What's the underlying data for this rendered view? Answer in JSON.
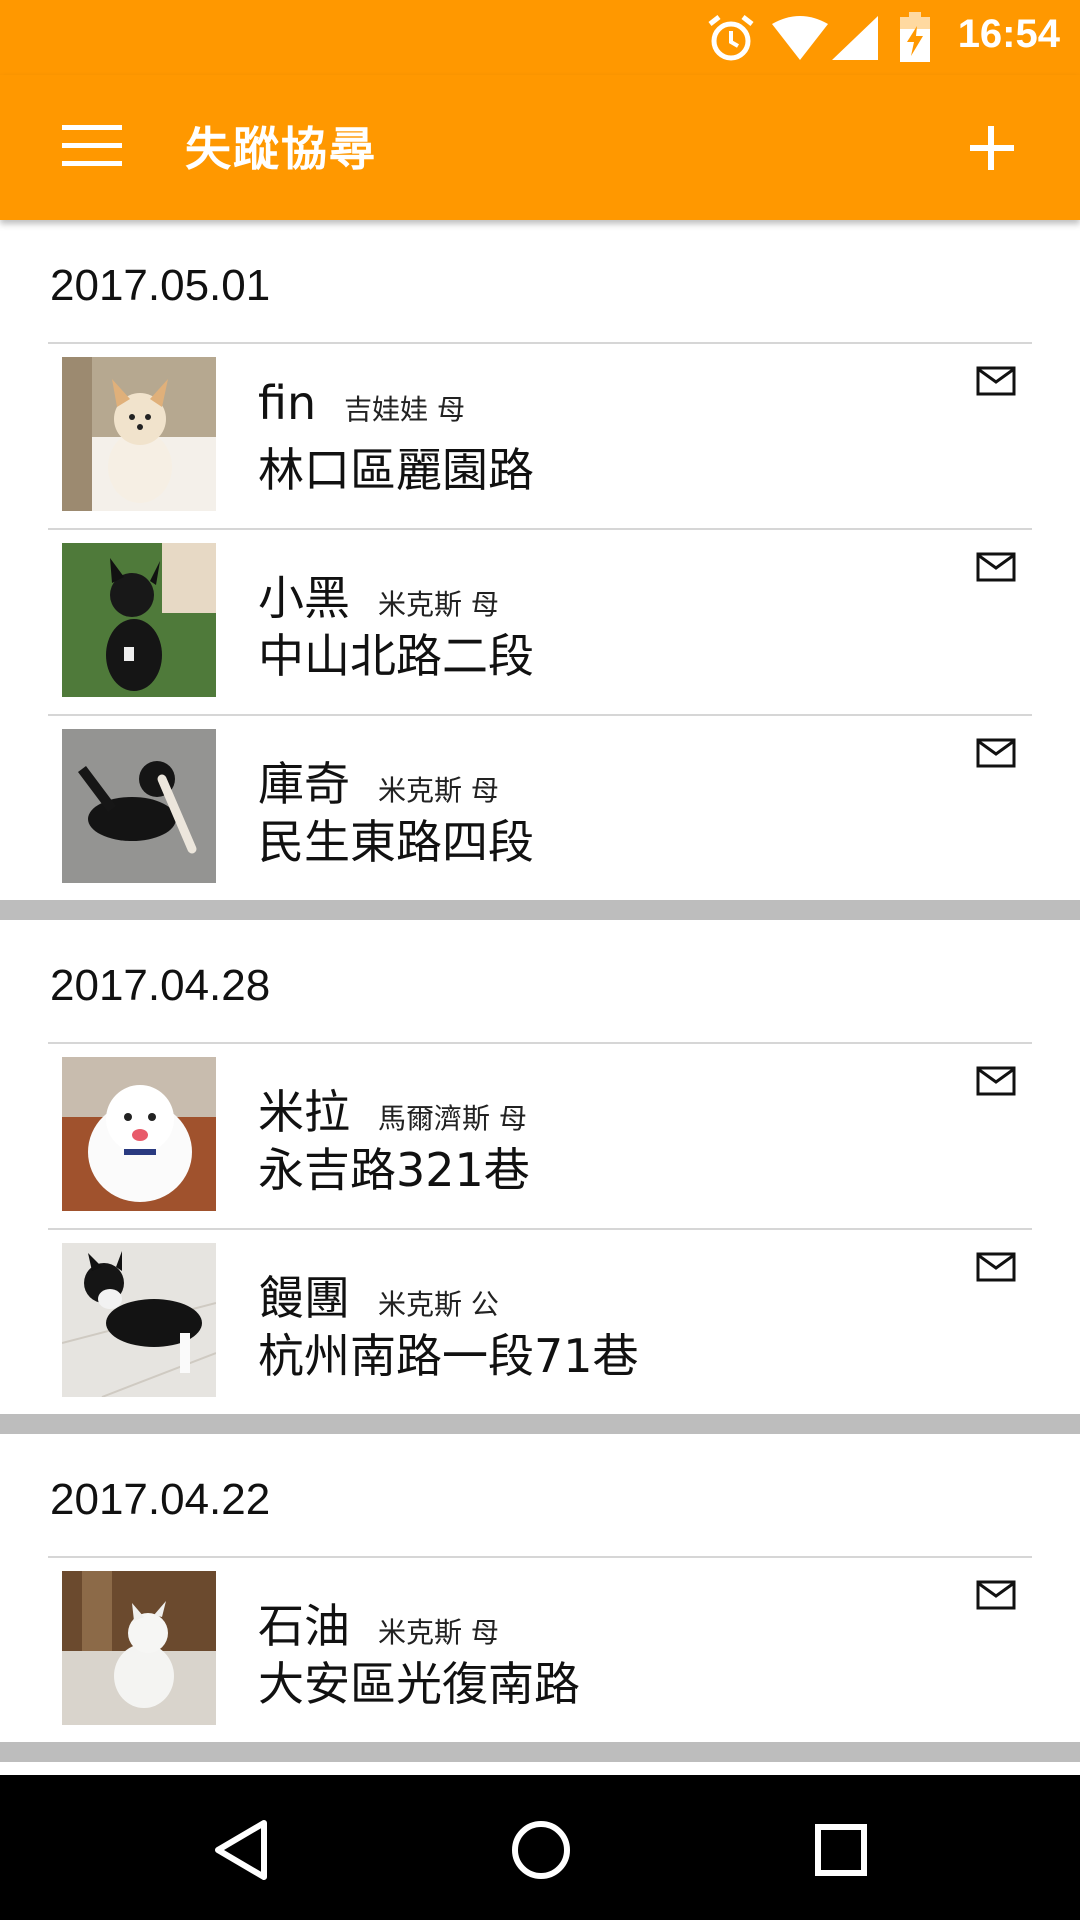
{
  "status": {
    "time": "16:54"
  },
  "appbar": {
    "title": "失蹤協尋",
    "menu_icon": "menu-icon",
    "add_icon": "plus-icon"
  },
  "colors": {
    "primary": "#ff9800",
    "divider": "#d6d6d6",
    "background": "#bdbdbd"
  },
  "groups": [
    {
      "date": "2017.05.01",
      "items": [
        {
          "name": "fin",
          "breed": "吉娃娃 母",
          "address": "林口區麗園路"
        },
        {
          "name": "小黑",
          "breed": "米克斯 母",
          "address": "中山北路二段"
        },
        {
          "name": "庫奇",
          "breed": "米克斯 母",
          "address": "民生東路四段"
        }
      ]
    },
    {
      "date": "2017.04.28",
      "items": [
        {
          "name": "米拉",
          "breed": "馬爾濟斯 母",
          "address": "永吉路321巷"
        },
        {
          "name": "饅團",
          "breed": "米克斯 公",
          "address": "杭州南路一段71巷"
        }
      ]
    },
    {
      "date": "2017.04.22",
      "items": [
        {
          "name": "石油",
          "breed": "米克斯 母",
          "address": "大安區光復南路"
        }
      ]
    }
  ],
  "navbar": {
    "back_icon": "back-triangle-icon",
    "home_icon": "home-circle-icon",
    "recents_icon": "recents-square-icon"
  }
}
